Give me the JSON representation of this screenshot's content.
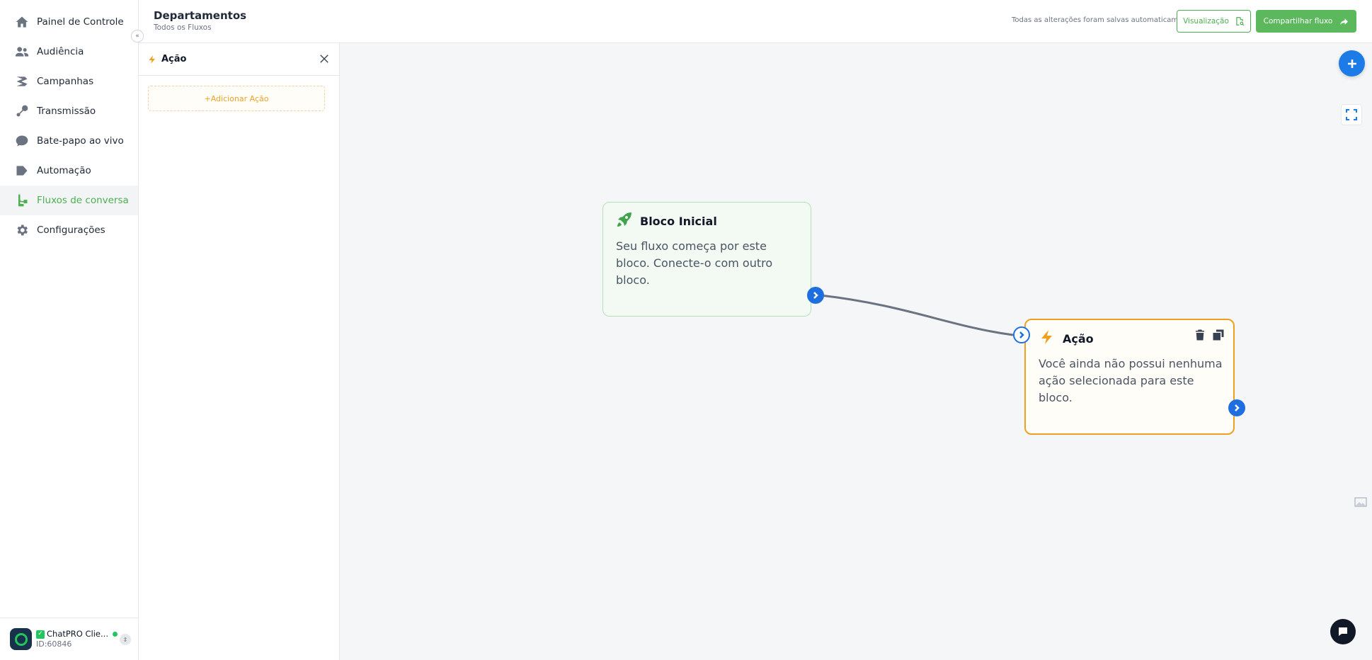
{
  "sidebar": {
    "items": [
      {
        "label": "Painel de Controle",
        "icon": "home-icon"
      },
      {
        "label": "Audiência",
        "icon": "users-icon"
      },
      {
        "label": "Campanhas",
        "icon": "campaign-icon"
      },
      {
        "label": "Transmissão",
        "icon": "broadcast-icon"
      },
      {
        "label": "Bate-papo ao vivo",
        "icon": "chat-icon"
      },
      {
        "label": "Automação",
        "icon": "automation-icon"
      },
      {
        "label": "Fluxos de conversa",
        "icon": "flow-icon",
        "active": true
      },
      {
        "label": "Configurações",
        "icon": "gear-icon"
      }
    ],
    "collapse_glyph": "«",
    "account": {
      "name": "ChatPRO Clie...",
      "id_label": "ID:60846"
    }
  },
  "header": {
    "title": "Departamentos",
    "subtitle": "Todos os Fluxos",
    "saved_status": "Todas as alterações foram salvas automaticamente",
    "preview_label": "Visualização",
    "share_label": "Compartilhar fluxo"
  },
  "panel": {
    "title": "Ação",
    "add_action_label": "+Adicionar Ação"
  },
  "canvas": {
    "start_node": {
      "title": "Bloco Inicial",
      "text": "Seu fluxo começa por este bloco. Conecte-o com outro bloco."
    },
    "action_node": {
      "title": "Ação",
      "text": "Você ainda não possui nenhuma ação selecionada para este bloco."
    }
  },
  "colors": {
    "brand_green": "#4caf50",
    "action_orange": "#f0a020",
    "handle_blue": "#1d6fe0"
  }
}
